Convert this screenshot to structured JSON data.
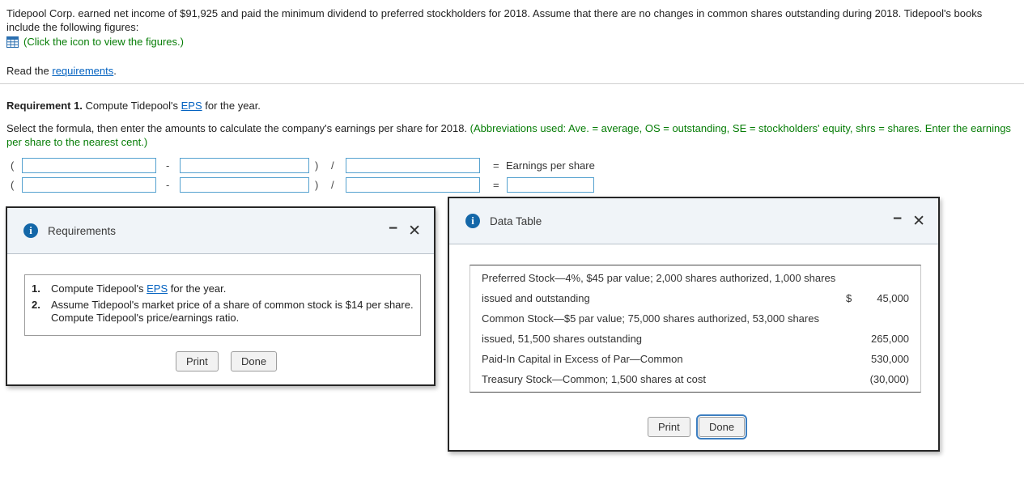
{
  "colors": {
    "link_blue": "#0563c1",
    "instruction_green": "#067d06",
    "input_border_blue": "#55a1cf",
    "info_icon_blue": "#1467a8",
    "focus_ring_blue": "#3d7fc1",
    "dialog_header_bg": "#f0f4f8",
    "dialog_border": "#262626"
  },
  "icons": {
    "info_glyph": "i",
    "minimize_glyph": "−",
    "close_glyph": "✕",
    "table_icon": "spreadsheet-grid"
  },
  "intro": {
    "paragraph": "Tidepool Corp. earned net income of $91,925 and paid the minimum dividend to preferred stockholders for 2018. Assume that there are no changes in common shares outstanding during 2018. Tidepool's books include the following figures:",
    "icon_caption": "(Click the icon to view the figures.)",
    "read_prefix": "Read the ",
    "read_link_text": "requirements",
    "read_suffix": "."
  },
  "requirement1": {
    "label": "Requirement 1.",
    "text_before_link": " Compute Tidepool's ",
    "link_text": "EPS",
    "text_after_link": " for the year.",
    "instruction_black": "Select the formula, then enter the amounts to calculate the company's earnings per share for 2018. ",
    "instruction_green": "(Abbreviations used: Ave. = average, OS = outstanding, SE = stockholders' equity, shrs = shares. Enter the earnings per share to the nearest cent.)"
  },
  "formula": {
    "open_paren": "(",
    "minus_sign": "-",
    "close_paren": ")",
    "divide_sign": "/",
    "equals_sign": "=",
    "row1_result_label": "Earnings per share",
    "row1": {
      "input1": "",
      "input2": "",
      "input3": ""
    },
    "row2": {
      "input1": "",
      "input2": "",
      "input3": "",
      "result_input": ""
    }
  },
  "requirements_dialog": {
    "title": "Requirements",
    "items": [
      {
        "number": "1.",
        "text_before_link": "Compute Tidepool's ",
        "link_text": "EPS",
        "text_after_link": " for the year."
      },
      {
        "number": "2.",
        "text": "Assume Tidepool's market price of a share of common stock is $14 per share. Compute Tidepool's price/earnings ratio."
      }
    ],
    "print_button": "Print",
    "done_button": "Done"
  },
  "data_table_dialog": {
    "title": "Data Table",
    "lines": [
      {
        "text": "Preferred Stock—4%, $45 par value; 2,000 shares authorized, 1,000 shares",
        "currency": "",
        "amount": ""
      },
      {
        "text": "issued and outstanding",
        "currency": "$",
        "amount": "45,000"
      },
      {
        "text": "Common Stock—$5 par value; 75,000 shares authorized, 53,000 shares",
        "currency": "",
        "amount": ""
      },
      {
        "text": "issued, 51,500 shares outstanding",
        "currency": "",
        "amount": "265,000"
      },
      {
        "text": "Paid-In Capital in Excess of Par—Common",
        "currency": "",
        "amount": "530,000"
      },
      {
        "text": "Treasury Stock—Common; 1,500 shares at cost",
        "currency": "",
        "amount": "(30,000)"
      }
    ],
    "print_button": "Print",
    "done_button": "Done"
  }
}
